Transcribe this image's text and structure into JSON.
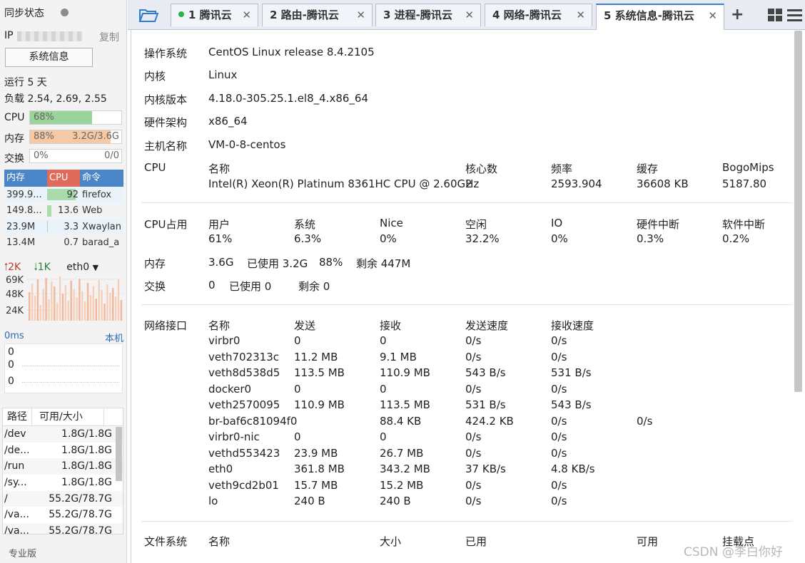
{
  "sidebar": {
    "sync_label": "同步状态",
    "ip_label": "IP",
    "copy_label": "复制",
    "sysinfo_button": "系统信息",
    "uptime": "运行 5 天",
    "load": "负载 2.54, 2.69, 2.55",
    "cpu": {
      "label": "CPU",
      "value": "68%",
      "fraction": 0.68,
      "color": "#9ad49a"
    },
    "mem": {
      "label": "内存",
      "value": "88%",
      "detail": "3.2G/3.6G",
      "fraction": 0.88,
      "color": "#f6c9a4"
    },
    "swap": {
      "label": "交换",
      "value": "0%",
      "detail": "0/0",
      "fraction": 0
    },
    "proc_headers": [
      "内存",
      "CPU",
      "命令"
    ],
    "processes": [
      {
        "mem": "399.9...",
        "cpu": "92",
        "cmd": "firefox"
      },
      {
        "mem": "149.8...",
        "cpu": "13.6",
        "cmd": "Web"
      },
      {
        "mem": "23.9M",
        "cpu": "3.3",
        "cmd": "Xwaylan"
      },
      {
        "mem": "13.4M",
        "cpu": "0.7",
        "cmd": "barad_a"
      }
    ],
    "net": {
      "up": "2K",
      "down": "1K",
      "iface": "eth0",
      "ticks": [
        "69K",
        "48K",
        "24K"
      ]
    },
    "ping": {
      "label": "0ms",
      "host": "本机",
      "values": [
        "0",
        "0",
        "0"
      ]
    },
    "disk_headers": [
      "路径",
      "可用/大小"
    ],
    "disks": [
      {
        "path": "/dev",
        "size": "1.8G/1.8G"
      },
      {
        "path": "/de...",
        "size": "1.8G/1.8G"
      },
      {
        "path": "/run",
        "size": "1.8G/1.8G"
      },
      {
        "path": "/sy...",
        "size": "1.8G/1.8G"
      },
      {
        "path": "/",
        "size": "55.2G/78.7G"
      },
      {
        "path": "/va...",
        "size": "55.2G/78.7G"
      },
      {
        "path": "/va...",
        "size": "55.2G/78.7G"
      }
    ],
    "edition": "专业版"
  },
  "tabs": [
    {
      "label": "1 腾讯云",
      "active": false,
      "dot": true
    },
    {
      "label": "2 路由-腾讯云",
      "active": false
    },
    {
      "label": "3 进程-腾讯云",
      "active": false
    },
    {
      "label": "4 网络-腾讯云",
      "active": false
    },
    {
      "label": "5 系统信息-腾讯云",
      "active": true
    }
  ],
  "info": {
    "os_label": "操作系统",
    "os": "CentOS Linux release 8.4.2105",
    "kernel_label": "内核",
    "kernel": "Linux",
    "kver_label": "内核版本",
    "kver": "4.18.0-305.25.1.el8_4.x86_64",
    "arch_label": "硬件架构",
    "arch": "x86_64",
    "host_label": "主机名称",
    "host": "VM-0-8-centos",
    "cpu_label": "CPU",
    "cpu_headers": [
      "名称",
      "核心数",
      "频率",
      "缓存",
      "BogoMips"
    ],
    "cpu_values": [
      "Intel(R) Xeon(R) Platinum 8361HC CPU @ 2.60GHz",
      "2",
      "2593.904",
      "36608 KB",
      "5187.80"
    ],
    "cpu_usage_label": "CPU占用",
    "usage_headers": [
      "用户",
      "系统",
      "Nice",
      "空闲",
      "IO",
      "硬件中断",
      "软件中断"
    ],
    "usage_values": [
      "61%",
      "6.3%",
      "0%",
      "32.2%",
      "0%",
      "0.3%",
      "0.2%"
    ],
    "mem_label": "内存",
    "mem_total": "3.6G",
    "mem_used": "已使用 3.2G",
    "mem_pct": "88%",
    "mem_free": "剩余 447M",
    "swap_label": "交换",
    "swap_total": "0",
    "swap_used": "已使用 0",
    "swap_free": "剩余 0",
    "net_label": "网络接口",
    "net_headers": [
      "名称",
      "发送",
      "接收",
      "发送速度",
      "接收速度"
    ],
    "interfaces": [
      [
        "virbr0",
        "0",
        "0",
        "0/s",
        "0/s",
        ""
      ],
      [
        "veth702313c",
        "11.2 MB",
        "9.1 MB",
        "0/s",
        "0/s",
        ""
      ],
      [
        "veth8d538d5",
        "113.5 MB",
        "110.9 MB",
        "543 B/s",
        "531 B/s",
        ""
      ],
      [
        "docker0",
        "0",
        "0",
        "0/s",
        "0/s",
        ""
      ],
      [
        "veth2570095",
        "110.9 MB",
        "113.5 MB",
        "531 B/s",
        "543 B/s",
        ""
      ],
      [
        "br-baf6c81094f0",
        "",
        "88.4 KB",
        "424.2 KB",
        "0/s",
        "0/s"
      ],
      [
        "virbr0-nic",
        "0",
        "0",
        "0/s",
        "0/s",
        ""
      ],
      [
        "vethd553423",
        "23.9 MB",
        "26.7 MB",
        "0/s",
        "0/s",
        ""
      ],
      [
        "eth0",
        "361.8 MB",
        "343.2 MB",
        "37 KB/s",
        "4.8 KB/s",
        ""
      ],
      [
        "veth9cd2b01",
        "15.7 MB",
        "15.2 MB",
        "0/s",
        "0/s",
        ""
      ],
      [
        "lo",
        "240 B",
        "240 B",
        "0/s",
        "0/s",
        ""
      ]
    ],
    "fs_label": "文件系统",
    "fs_headers": [
      "名称",
      "大小",
      "已用",
      "可用",
      "挂载点"
    ]
  },
  "watermark": "CSDN @李白你好",
  "colors": {
    "accent": "#3d7bd6",
    "mem_header": "#4a86c8",
    "cpu_header": "#e06b5c",
    "cmd_header": "#4a86c8"
  }
}
